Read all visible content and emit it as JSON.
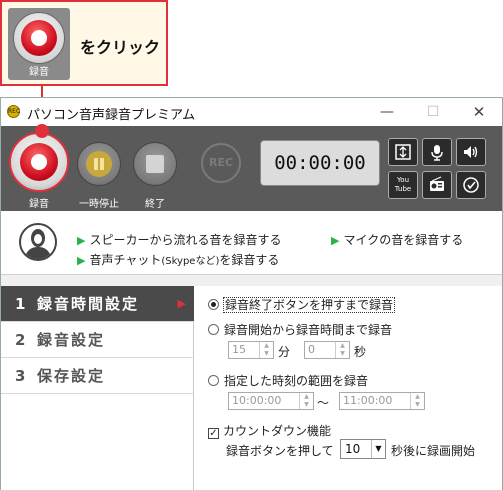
{
  "callout": {
    "text": "をクリック",
    "button_label": "録音"
  },
  "window": {
    "title": "パソコン音声録音プレミアム",
    "app_icon_text": "REC",
    "minimize": "—",
    "maximize": "☐",
    "close": "✕"
  },
  "toolbar": {
    "record_label": "録音",
    "pause_label": "一時停止",
    "stop_label": "終了",
    "rec_indicator": "REC",
    "timer": "00:00:00",
    "icons": [
      "fit-window-icon",
      "microphone-icon",
      "speaker-volume-icon",
      "youtube-icon",
      "radio-icon",
      "help-icon"
    ],
    "youtube_text": "You Tube"
  },
  "info": {
    "speaker": "スピーカーから流れる音を録音する",
    "mic": "マイクの音を録音する",
    "chat_prefix": "音声チャット",
    "chat_paren": "(Skypeなど)",
    "chat_suffix": "を録音する"
  },
  "sidebar": {
    "items": [
      {
        "num": "1",
        "label": "録音時間設定",
        "active": true
      },
      {
        "num": "2",
        "label": "録音設定",
        "active": false
      },
      {
        "num": "3",
        "label": "保存設定",
        "active": false
      }
    ],
    "caret": "▶"
  },
  "settings": {
    "option1": "録音終了ボタンを押すまで録音",
    "option2": "録音開始から録音時間まで録音",
    "minutes_value": "15",
    "minutes_unit": "分",
    "seconds_value": "0",
    "seconds_unit": "秒",
    "option3": "指定した時刻の範囲を録音",
    "time_start": "10:00:00",
    "tilde": "～",
    "time_end": "11:00:00",
    "countdown_label": "カウントダウン機能",
    "countdown_checked": "✓",
    "countdown_prefix": "録音ボタンを押して",
    "countdown_value": "10",
    "countdown_suffix": "秒後に録画開始"
  },
  "colors": {
    "accent_red": "#e0303a",
    "toolbar_bg": "#5a5a5a",
    "arrow_green": "#2bb24c"
  }
}
